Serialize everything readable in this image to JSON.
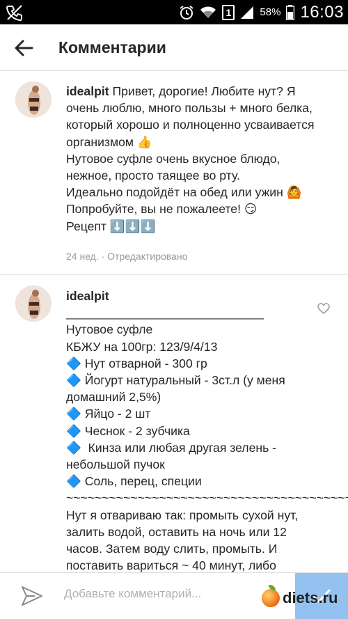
{
  "status_bar": {
    "battery_percent": "58%",
    "time": "16:03",
    "sim_number": "1"
  },
  "header": {
    "title": "Комментарии"
  },
  "comments": [
    {
      "username": "idealpit",
      "text": " Привет, дорогие! Любите нут? Я очень люблю, много пользы + много белка, который хорошо и полноценно усваивается организмом 👍\nНутовое суфле очень вкусное блюдо, нежное, просто таящее во рту.\nИдеально подойдёт на обед или ужин 🙆\nПопробуйте, вы не пожалеете! 😏\nРецепт ⬇️⬇️⬇️",
      "meta": "24 нед. · Отредактировано"
    },
    {
      "username": "idealpit",
      "text": " _____________________________\nНутовое суфле\nКБЖУ на 100гр: 123/9/4/13\n🔷 Нут отварной - 300 гр\n🔷 Йогурт натуральный - 3ст.л (у меня домашний 2,5%)\n🔷 Яйцо - 2 шт\n🔷 Чеснок - 2 зубчика\n🔷  Кинза или любая другая зелень - небольшой пучок\n🔷 Соль, перец, специи\n~~~~~~~~~~~~~~~~~~~~~~~~~~~~~~~~~~~~~~~~\nНут я отвариваю так: промыть сухой нут, залить водой, оставить на ночь или 12 часов. Затем воду слить, промыть. И поставить вариться ~ 40 минут, либо смотрите по готовности."
    }
  ],
  "compose": {
    "placeholder": "Добавьте комментарий..."
  },
  "watermark": "diets.ru",
  "colors": {
    "post_button": "#3b92e6",
    "text": "#262626",
    "meta": "#999999"
  }
}
